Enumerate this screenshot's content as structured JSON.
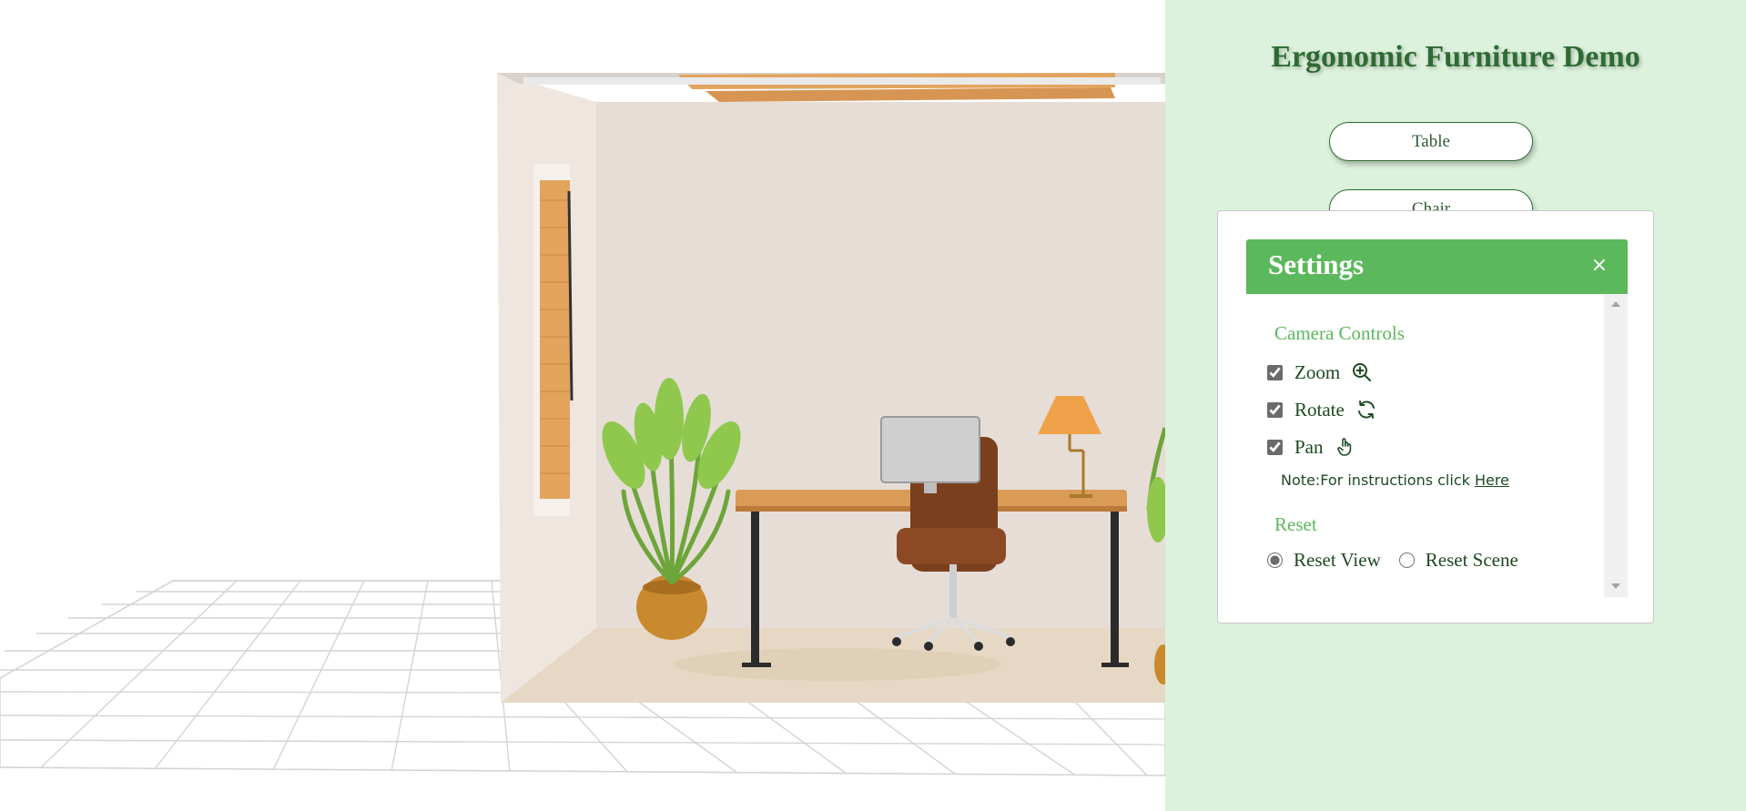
{
  "app": {
    "title": "Ergonomic Furniture Demo"
  },
  "furniture_buttons": {
    "table": "Table",
    "chair": "Chair"
  },
  "settings": {
    "title": "Settings",
    "close_label": "×",
    "camera_section": "Camera Controls",
    "options": {
      "zoom": {
        "label": "Zoom",
        "checked": true,
        "icon": "zoom-in-icon"
      },
      "rotate": {
        "label": "Rotate",
        "checked": true,
        "icon": "rotate-icon"
      },
      "pan": {
        "label": "Pan",
        "checked": true,
        "icon": "hand-pan-icon"
      }
    },
    "note_prefix": "Note:For instructions click ",
    "note_link": "Here",
    "reset_section": "Reset",
    "reset_options": {
      "view": {
        "label": "Reset View",
        "selected": true
      },
      "scene": {
        "label": "Reset Scene",
        "selected": false
      }
    }
  },
  "colors": {
    "panel_bg": "#dcf2dc",
    "accent_green": "#5cb85c",
    "dark_green": "#2e6b34"
  }
}
